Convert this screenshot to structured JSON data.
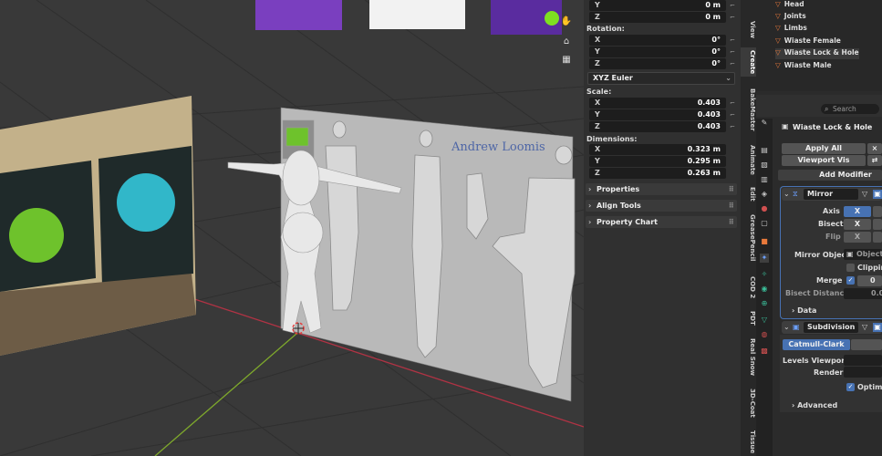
{
  "transform": {
    "location": {
      "y": "0 m",
      "z": "0 m"
    },
    "rotation_label": "Rotation:",
    "rotation": {
      "x": "0°",
      "y": "0°",
      "z": "0°"
    },
    "rotation_mode": "XYZ Euler",
    "scale_label": "Scale:",
    "scale": {
      "x": "0.403",
      "y": "0.403",
      "z": "0.403"
    },
    "dimensions_label": "Dimensions:",
    "dimensions": {
      "x": "0.323 m",
      "y": "0.295 m",
      "z": "0.263 m"
    },
    "axes": {
      "x": "X",
      "y": "Y",
      "z": "Z"
    }
  },
  "panels": [
    "Properties",
    "Align Tools",
    "Property Chart"
  ],
  "tabs": [
    "View",
    "Create",
    "BakeMaster",
    "Animate",
    "Edit",
    "GreasePencil",
    "COD 2",
    "PDT",
    "Real Snow",
    "3D-Coat",
    "Tissue"
  ],
  "reference_image": {
    "title": "Andrew Loomis"
  },
  "outliner": [
    "Head",
    "Joints",
    "Limbs",
    "Wiaste Female",
    "Wiaste Lock & Hole",
    "Wiaste Male"
  ],
  "properties": {
    "search_placeholder": "Search",
    "object_name": "Wiaste Lock & Hole",
    "apply_all": "Apply All",
    "viewport_vis": "Viewport Vis",
    "add_modifier": "Add Modifier",
    "mirror": {
      "name": "Mirror",
      "axis_label": "Axis",
      "bisect_label": "Bisect",
      "flip_label": "Flip",
      "axis_x": "X",
      "bisect_x": "X",
      "flip_x": "X",
      "mirror_object_label": "Mirror Object",
      "mirror_object_value": "Object",
      "clipping_label": "Clipping",
      "merge_label": "Merge",
      "merge_value": "0",
      "bisect_distance_label": "Bisect Distance",
      "bisect_distance_value": "0.0",
      "data_label": "Data"
    },
    "subdivision": {
      "name": "Subdivision",
      "type": "Catmull-Clark",
      "levels_viewport_label": "Levels Viewport",
      "render_label": "Render",
      "optimal_label": "Optimal",
      "advanced_label": "Advanced"
    }
  },
  "colors": {
    "accent_blue": "#4772b3",
    "orange": "#e8793b",
    "teal": "#3bbf9a"
  }
}
